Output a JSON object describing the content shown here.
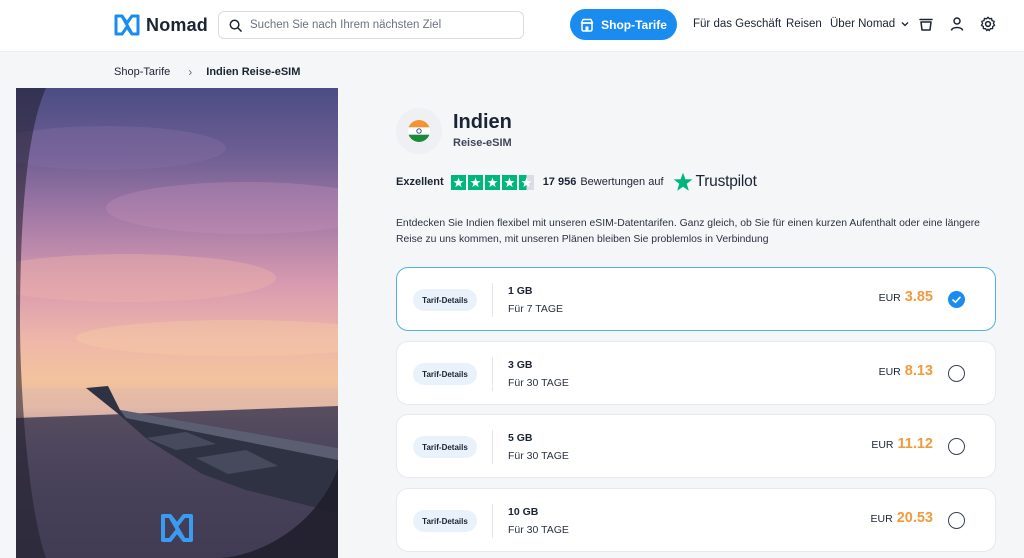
{
  "header": {
    "logo_text": "Nomad",
    "search_placeholder": "Suchen Sie nach Ihrem nächsten Ziel",
    "shop_button": "Shop-Tarife",
    "nav": {
      "business": "Für das Geschäft",
      "travel": "Reisen",
      "about": "Über Nomad"
    },
    "icons": [
      "cart-icon",
      "user-icon",
      "settings-icon"
    ]
  },
  "breadcrumb": {
    "parent": "Shop-Tarife",
    "separator": "›",
    "current": "Indien Reise-eSIM"
  },
  "product": {
    "country": "Indien",
    "subtitle": "Reise-eSIM",
    "rating_label": "Exzellent",
    "rating_stars": 4.5,
    "reviews_count": "17 956",
    "reviews_label": "Bewertungen auf",
    "trustpilot": "Trustpilot",
    "description": "Entdecken Sie Indien flexibel mit unseren eSIM-Datentarifen. Ganz gleich, ob Sie für einen kurzen Aufenthalt oder eine längere Reise zu uns kommen, mit unseren Plänen bleiben Sie problemlos in Verbindung"
  },
  "plans": [
    {
      "details": "Tarif-Details",
      "data": "1 GB",
      "duration": "Für 7 TAGE",
      "currency": "EUR",
      "price": "3.85",
      "selected": true
    },
    {
      "details": "Tarif-Details",
      "data": "3 GB",
      "duration": "Für 30 TAGE",
      "currency": "EUR",
      "price": "8.13",
      "selected": false
    },
    {
      "details": "Tarif-Details",
      "data": "5 GB",
      "duration": "Für 30 TAGE",
      "currency": "EUR",
      "price": "11.12",
      "selected": false
    },
    {
      "details": "Tarif-Details",
      "data": "10 GB",
      "duration": "Für 30 TAGE",
      "currency": "EUR",
      "price": "20.53",
      "selected": false
    }
  ],
  "colors": {
    "brand_blue": "#1a8cf0",
    "price_orange": "#f29a3c",
    "trustpilot_green": "#00b67a"
  }
}
